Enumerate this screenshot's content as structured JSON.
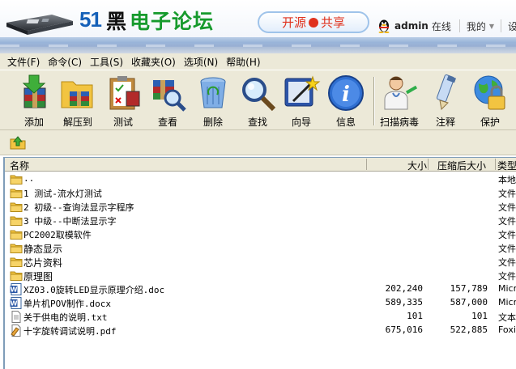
{
  "site": {
    "logo_num": "51",
    "logo_hei": "黑",
    "logo_rest": "电子论坛",
    "pill_left": "开源",
    "pill_right": "共享",
    "username": "admin",
    "status": "在线",
    "my_menu": "我的",
    "settings": "设置"
  },
  "menu": [
    "文件(F)",
    "命令(C)",
    "工具(S)",
    "收藏夹(O)",
    "选项(N)",
    "帮助(H)"
  ],
  "toolbar": {
    "add": "添加",
    "extract": "解压到",
    "test": "测试",
    "view": "查看",
    "delete": "删除",
    "find": "查找",
    "wizard": "向导",
    "info": "信息",
    "virus": "扫描病毒",
    "comment": "注释",
    "protect": "保护"
  },
  "columns": {
    "name": "名称",
    "size": "大小",
    "packed": "压缩后大小",
    "type": "类型"
  },
  "files": [
    {
      "name": "..",
      "size": "",
      "packed": "",
      "type": "本地",
      "icon": "folder-icon"
    },
    {
      "name": "1  测试-流水灯测试",
      "size": "",
      "packed": "",
      "type": "文件",
      "icon": "folder-icon"
    },
    {
      "name": "2 初级--查询法显示字程序",
      "size": "",
      "packed": "",
      "type": "文件",
      "icon": "folder-icon"
    },
    {
      "name": "3 中级--中断法显示字",
      "size": "",
      "packed": "",
      "type": "文件",
      "icon": "folder-icon"
    },
    {
      "name": "PC2002取模软件",
      "size": "",
      "packed": "",
      "type": "文件",
      "icon": "folder-icon"
    },
    {
      "name": "静态显示",
      "size": "",
      "packed": "",
      "type": "文件",
      "icon": "folder-icon"
    },
    {
      "name": "芯片资料",
      "size": "",
      "packed": "",
      "type": "文件",
      "icon": "folder-icon"
    },
    {
      "name": "原理图",
      "size": "",
      "packed": "",
      "type": "文件",
      "icon": "folder-icon"
    },
    {
      "name": "XZ03.0旋转LED显示原理介绍.doc",
      "size": "202,240",
      "packed": "157,789",
      "type": "Micr",
      "icon": "word-doc-icon"
    },
    {
      "name": "单片机POV制作.docx",
      "size": "589,335",
      "packed": "587,000",
      "type": "Micr",
      "icon": "word-doc-icon"
    },
    {
      "name": "关于供电的说明.txt",
      "size": "101",
      "packed": "101",
      "type": "文本",
      "icon": "text-file-icon"
    },
    {
      "name": "十字旋转调试说明.pdf",
      "size": "675,016",
      "packed": "522,885",
      "type": "Foxi",
      "icon": "pdf-file-icon"
    }
  ],
  "colors": {
    "accent_blue": "#1560b8",
    "logo_green": "#169a2c",
    "pill_red": "#e0321e",
    "chrome": "#ece9d8"
  }
}
